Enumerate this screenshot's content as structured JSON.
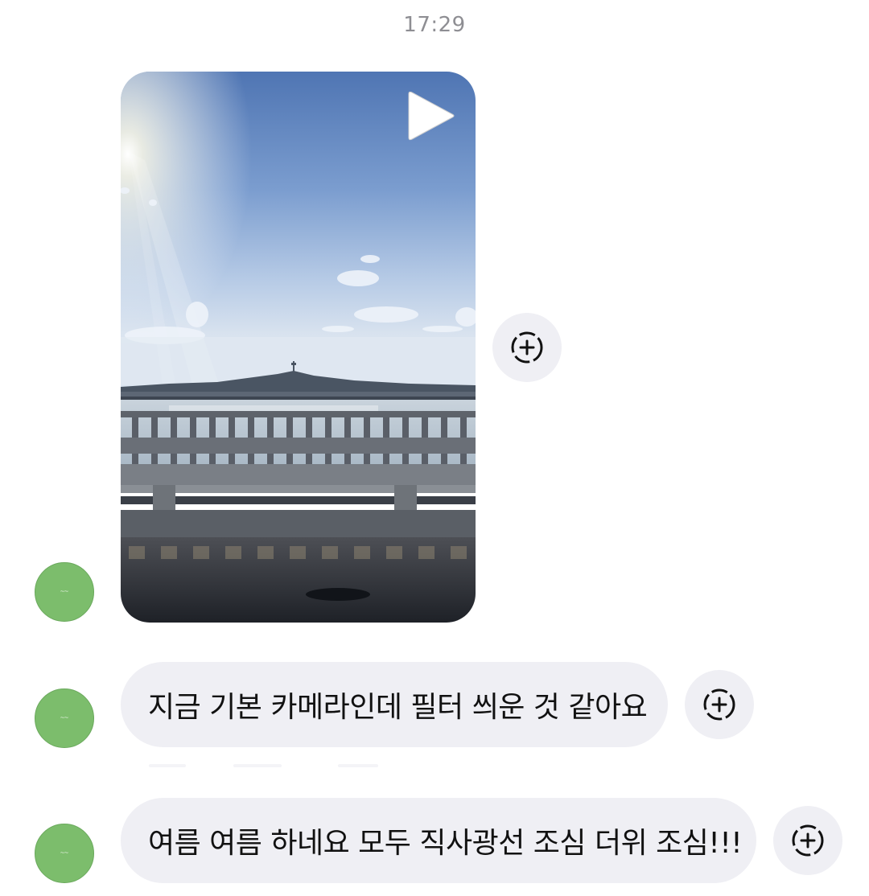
{
  "thread": {
    "timestamp": "17:29"
  },
  "messages": [
    {
      "type": "video",
      "sender_avatar_color": "#7cbd6c",
      "thumbnail": "bridge-river-sky-scene",
      "play_icon": "play-icon",
      "reaction_icon": "add-reaction-icon"
    },
    {
      "type": "text",
      "text": "지금 기본 카메라인데 필터 씌운 것 같아요",
      "reaction_icon": "add-reaction-icon"
    },
    {
      "type": "text",
      "text": "여름 여름 하네요 모두 직사광선 조심 더위 조심!!!",
      "reaction_icon": "add-reaction-icon"
    }
  ],
  "colors": {
    "bubble_background": "#efeff4",
    "timestamp_text": "#8e8e93",
    "avatar": "#7cbd6c"
  }
}
